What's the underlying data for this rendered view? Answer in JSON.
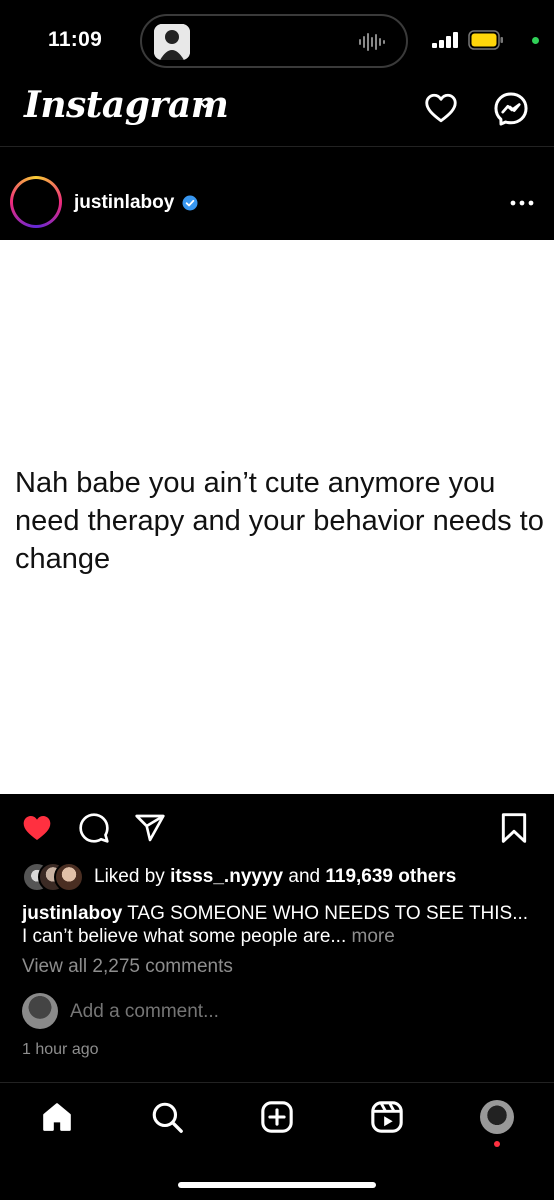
{
  "status_bar": {
    "time": "11:09"
  },
  "header": {
    "app_name": "Instagram"
  },
  "post": {
    "username": "justinlaboy",
    "verified": true,
    "image_text": "Nah babe you ain’t cute anymore you need therapy and your behavior needs to change",
    "liked": true,
    "likes": {
      "prefix": "Liked by",
      "first_user": "itsss_.nyyyy",
      "joiner": "and",
      "others": "119,639 others"
    },
    "caption": {
      "username": "justinlaboy",
      "text": "TAG SOMEONE WHO NEEDS TO SEE THIS... I can’t believe what some people are...",
      "more": "more"
    },
    "view_comments": "View all 2,275 comments",
    "comment_placeholder": "Add a comment...",
    "timestamp": "1 hour ago"
  },
  "icons": {
    "header": [
      "chevron-down-icon",
      "heart-icon",
      "messenger-icon"
    ],
    "actions": [
      "like-icon",
      "comment-icon",
      "share-icon",
      "save-icon"
    ],
    "tabs": [
      "home-icon",
      "search-icon",
      "create-icon",
      "reels-icon",
      "profile-icon"
    ]
  },
  "colors": {
    "like_red": "#ff3040",
    "verified_blue": "#3897f0",
    "muted": "#8e8e8e"
  }
}
